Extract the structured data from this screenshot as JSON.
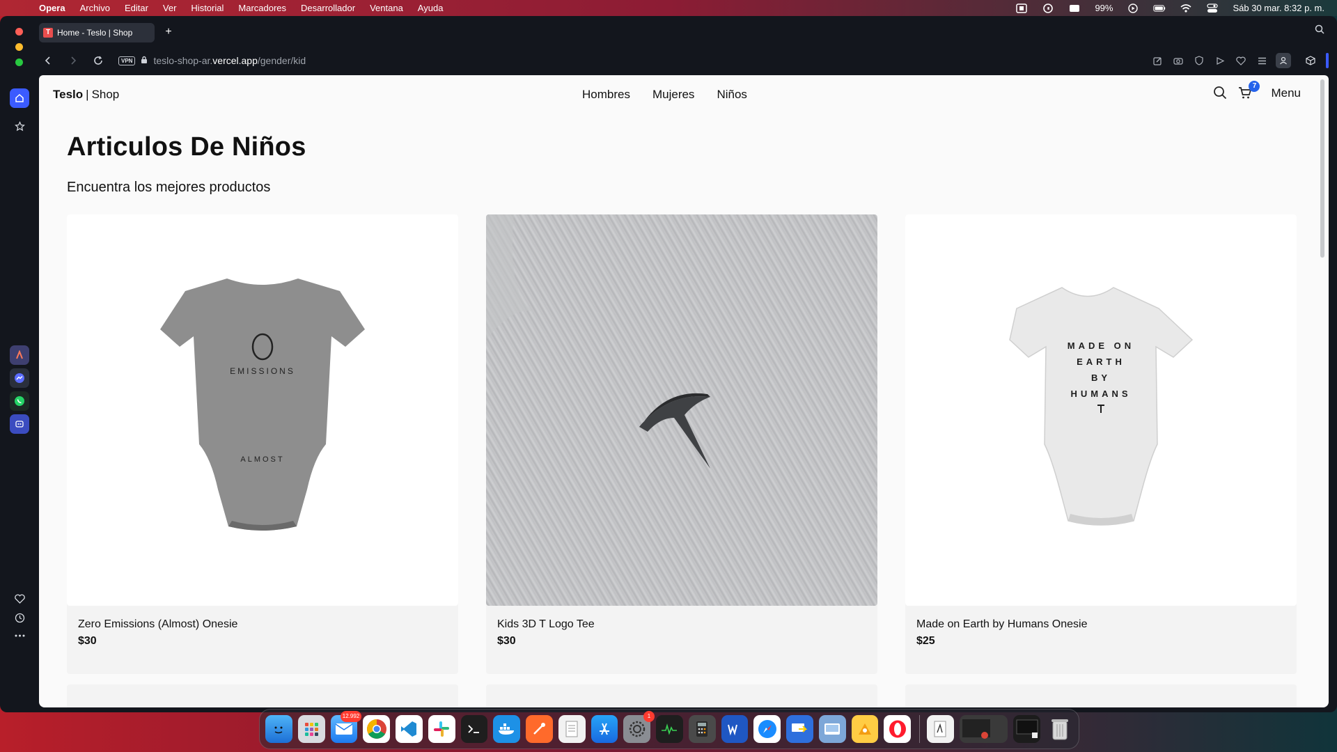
{
  "menubar": {
    "app": "Opera",
    "items": [
      "Archivo",
      "Editar",
      "Ver",
      "Historial",
      "Marcadores",
      "Desarrollador",
      "Ventana",
      "Ayuda"
    ],
    "battery": "99%",
    "datetime": "Sáb 30 mar.  8:32 p. m."
  },
  "browser": {
    "tab_title": "Home - Teslo | Shop",
    "tab_favicon": "T",
    "new_tab": "+",
    "vpn_label": "VPN",
    "url_prefix": "teslo-shop-ar.",
    "url_domain": "vercel.app",
    "url_path": "/gender/kid"
  },
  "site": {
    "logo_brand": "Teslo",
    "logo_sep": "|",
    "logo_rest": "Shop",
    "nav": [
      "Hombres",
      "Mujeres",
      "Niños"
    ],
    "cart_count": "7",
    "menu_label": "Menu",
    "page_title": "Articulos De Niños",
    "page_subtitle": "Encuentra los mejores productos"
  },
  "products": [
    {
      "name": "Zero Emissions (Almost) Onesie",
      "price": "$30",
      "print_top": "EMISSIONS",
      "print_bottom": "ALMOST"
    },
    {
      "name": "Kids 3D T Logo Tee",
      "price": "$30"
    },
    {
      "name": "Made on Earth by Humans Onesie",
      "price": "$25",
      "print_lines": [
        "MADE ON",
        "EARTH",
        "BY",
        "HUMANS"
      ]
    }
  ],
  "dock": {
    "mail_badge": "12.992",
    "settings_badge": "1"
  },
  "colors": {
    "accent": "#3b5bff",
    "cart_badge": "#2563eb"
  }
}
